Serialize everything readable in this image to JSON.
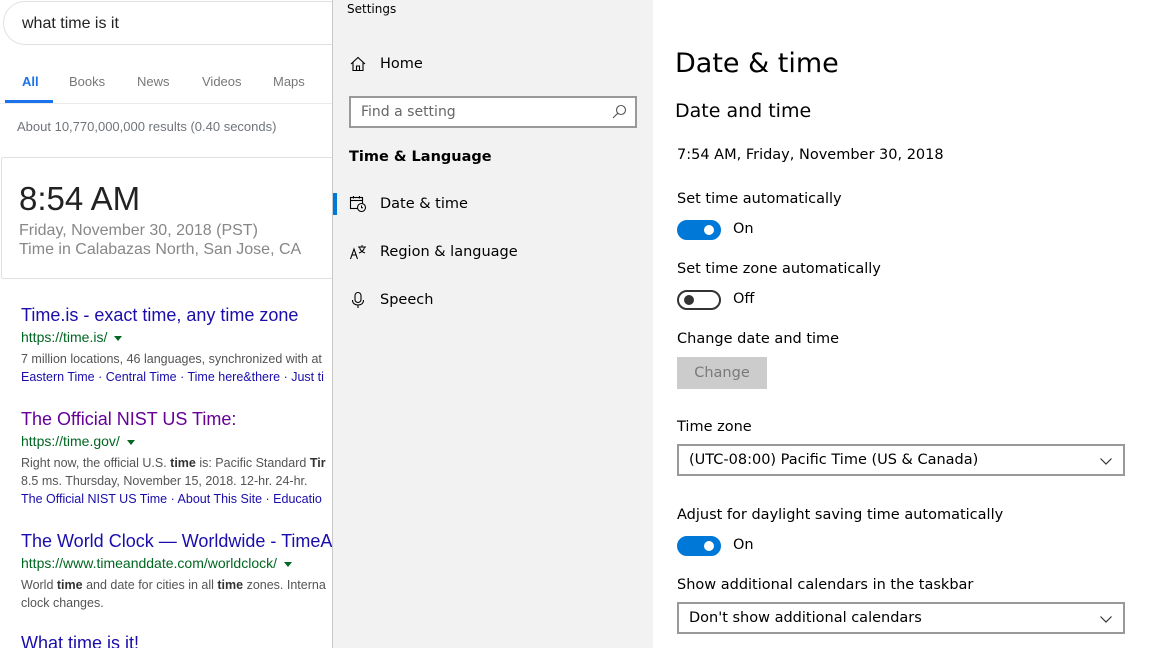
{
  "google": {
    "query": "what time is it",
    "tabs": [
      "All",
      "Books",
      "News",
      "Videos",
      "Maps"
    ],
    "stats": "About 10,770,000,000 results (0.40 seconds)",
    "time_card": {
      "time": "8:54 AM",
      "date": "Friday, November 30, 2018 (PST)",
      "location": "Time in Calabazas North, San Jose, CA"
    },
    "results": [
      {
        "title": "Time.is - exact time, any time zone",
        "url": "https://time.is/",
        "snippet": "7 million locations, 46 languages, synchronized with at",
        "links": "Eastern Time · Central Time · Time here&there · Just ti"
      },
      {
        "title": "The Official NIST US Time:",
        "url": "https://time.gov/",
        "snippet_parts": [
          "Right now, the official U.S. ",
          "time",
          " is: Pacific Standard ",
          "Tir"
        ],
        "snippet2": "8.5 ms. Thursday, November 15, 2018. 12-hr. 24-hr.",
        "links": "The Official NIST US Time · About This Site · Educatio"
      },
      {
        "title": "The World Clock — Worldwide - TimeAn",
        "url": "https://www.timeanddate.com/worldclock/",
        "snippet_parts": [
          "World ",
          "time",
          " and date for cities in all ",
          "time",
          " zones. Interna"
        ],
        "snippet2": "clock changes."
      },
      {
        "title": "What time is it!"
      }
    ]
  },
  "settings": {
    "window_title": "Settings",
    "nav": {
      "home": "Home",
      "search_placeholder": "Find a setting",
      "section": "Time & Language",
      "items": [
        "Date & time",
        "Region & language",
        "Speech"
      ]
    },
    "page": {
      "title": "Date & time",
      "subtitle": "Date and time",
      "current": "7:54 AM, Friday, November 30, 2018",
      "set_time_auto": {
        "label": "Set time automatically",
        "state": "On"
      },
      "set_tz_auto": {
        "label": "Set time zone automatically",
        "state": "Off"
      },
      "change_label": "Change date and time",
      "change_button": "Change",
      "timezone_label": "Time zone",
      "timezone_value": "(UTC-08:00) Pacific Time (US & Canada)",
      "dst": {
        "label": "Adjust for daylight saving time automatically",
        "state": "On"
      },
      "calendars_label": "Show additional calendars in the taskbar",
      "calendars_value": "Don't show additional calendars"
    }
  },
  "colors": {
    "accent": "#0078d7",
    "google_link": "#1a0dab",
    "google_url": "#006621"
  }
}
